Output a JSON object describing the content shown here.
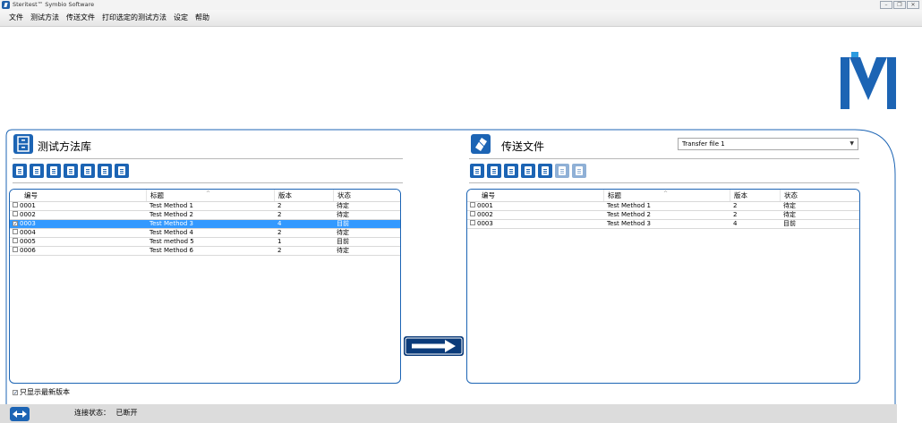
{
  "app": {
    "title": "Steritest™ Symbio Software"
  },
  "window_controls": [
    "–",
    "❐",
    "✕"
  ],
  "menu": [
    "文件",
    "测试方法",
    "传送文件",
    "打印选定的测试方法",
    "设定",
    "帮助"
  ],
  "left_panel": {
    "title": "测试方法库",
    "icon": "file-cabinet-icon",
    "toolbar_icons": [
      "print-icon",
      "copy-method-icon",
      "edit-method-icon",
      "export-method-icon",
      "import-method-icon",
      "details-method-icon",
      "delete-method-icon"
    ],
    "columns": [
      "编号",
      "标题",
      "版本",
      "状态"
    ],
    "rows": [
      {
        "id": "0001",
        "title": "Test Method 1",
        "version": "2",
        "status": "待定",
        "checked": false,
        "selected": false
      },
      {
        "id": "0002",
        "title": "Test Method 2",
        "version": "2",
        "status": "待定",
        "checked": false,
        "selected": false
      },
      {
        "id": "0003",
        "title": "Test Method 3",
        "version": "4",
        "status": "目前",
        "checked": true,
        "selected": true
      },
      {
        "id": "0004",
        "title": "Test Method 4",
        "version": "2",
        "status": "待定",
        "checked": false,
        "selected": false
      },
      {
        "id": "0005",
        "title": "Test method 5",
        "version": "1",
        "status": "目前",
        "checked": false,
        "selected": false
      },
      {
        "id": "0006",
        "title": "Test Method 6",
        "version": "2",
        "status": "待定",
        "checked": false,
        "selected": false
      }
    ]
  },
  "right_panel": {
    "title": "传送文件",
    "icon": "transfer-file-icon",
    "dropdown": {
      "value": "Transfer file 1"
    },
    "toolbar_icons": [
      "new-transfer-icon",
      "send-transfer-icon",
      "camera-icon",
      "print-icon",
      "copy-icon",
      "print-disabled-icon",
      "delete-disabled-icon"
    ],
    "columns": [
      "编号",
      "标题",
      "版本",
      "状态"
    ],
    "rows": [
      {
        "id": "0001",
        "title": "Test Method 1",
        "version": "2",
        "status": "待定",
        "checked": false
      },
      {
        "id": "0002",
        "title": "Test Method 2",
        "version": "2",
        "status": "待定",
        "checked": false
      },
      {
        "id": "0003",
        "title": "Test Method 3",
        "version": "4",
        "status": "目前",
        "checked": false
      }
    ]
  },
  "transfer_button": {
    "icon": "arrow-right-icon"
  },
  "options": {
    "latest_only_label": "只显示最新版本",
    "latest_only_checked": true
  },
  "status": {
    "icon": "connection-icon",
    "label": "连接状态：",
    "value": "已断开"
  },
  "colors": {
    "accent": "#1c64b4",
    "selection": "#3399ff",
    "frame": "#1c64b4",
    "status_bg": "#dcdcdc",
    "logo": "#1c64b4"
  }
}
